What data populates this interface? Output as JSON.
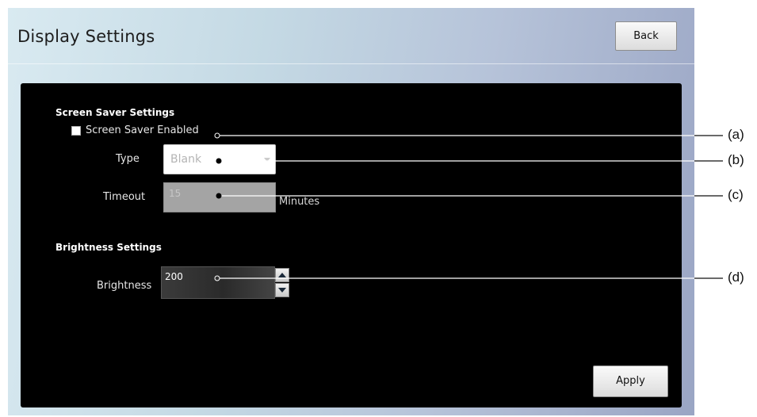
{
  "window": {
    "title": "Display Settings"
  },
  "header": {
    "back_label": "Back"
  },
  "screen_saver": {
    "heading": "Screen Saver Settings",
    "enabled_label": "Screen Saver Enabled",
    "enabled": false,
    "type_label": "Type",
    "type_value": "Blank",
    "timeout_label": "Timeout",
    "timeout_value": "15",
    "timeout_unit": "Minutes"
  },
  "brightness": {
    "heading": "Brightness Settings",
    "label": "Brightness",
    "value": "200"
  },
  "footer": {
    "apply_label": "Apply"
  },
  "callouts": {
    "a": "(a)",
    "b": "(b)",
    "c": "(c)",
    "d": "(d)"
  },
  "colors": {
    "panel_background": "#000000",
    "header_gradient_start": "#d9eaf1",
    "header_gradient_end": "#9aa5c4",
    "disabled_field": "#a4a4a4"
  },
  "icons": {
    "step_up": "triangle-up-icon",
    "step_down": "triangle-down-icon",
    "dropdown": "chevron-down-icon"
  }
}
